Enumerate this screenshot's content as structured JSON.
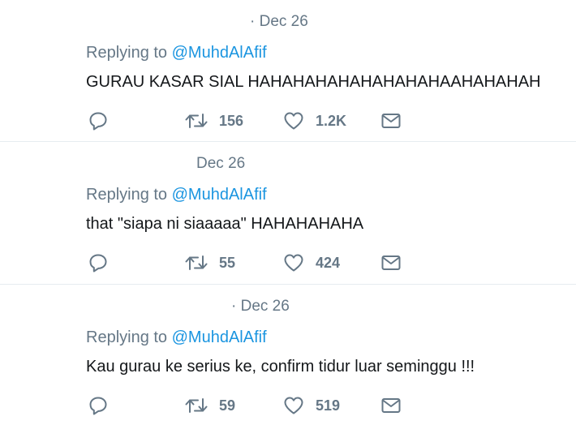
{
  "tweets": [
    {
      "date": "· Dec 26",
      "replying_prefix": "Replying to",
      "replying_handle": "@MuhdAlAfif",
      "text": "GURAU KASAR SIAL HAHAHAHAHAHAHAHAHAAHAHAHAH",
      "retweets": "156",
      "likes": "1.2K"
    },
    {
      "date": "Dec 26",
      "replying_prefix": "Replying to",
      "replying_handle": "@MuhdAlAfif",
      "text": "that \"siapa ni siaaaaa\" HAHAHAHAHA",
      "retweets": "55",
      "likes": "424"
    },
    {
      "date": "· Dec 26",
      "replying_prefix": "Replying to",
      "replying_handle": "@MuhdAlAfif",
      "text": "Kau gurau ke serius ke, confirm tidur luar seminggu !!!",
      "retweets": "59",
      "likes": "519"
    }
  ],
  "icons": {
    "reply": "reply-icon",
    "retweet": "retweet-icon",
    "like": "heart-icon",
    "dm": "envelope-icon"
  },
  "colors": {
    "text": "#14171a",
    "muted": "#657786",
    "link": "#1b95e0",
    "divider": "#e6ecf0"
  }
}
